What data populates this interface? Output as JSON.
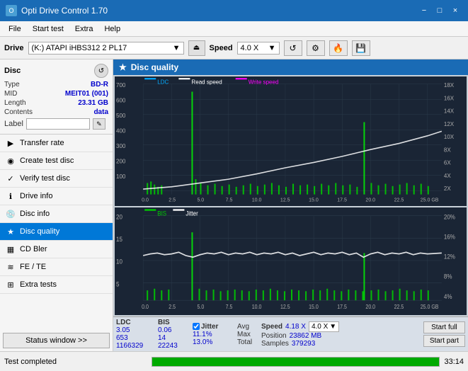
{
  "titleBar": {
    "title": "Opti Drive Control 1.70",
    "minBtn": "−",
    "maxBtn": "□",
    "closeBtn": "×"
  },
  "menuBar": {
    "items": [
      "File",
      "Start test",
      "Extra",
      "Help"
    ]
  },
  "driveBar": {
    "driveLabel": "Drive",
    "driveValue": "(K:) ATAPI iHBS312  2 PL17",
    "speedLabel": "Speed",
    "speedValue": "4.0 X"
  },
  "disc": {
    "title": "Disc",
    "typeLabel": "Type",
    "typeValue": "BD-R",
    "midLabel": "MID",
    "midValue": "MEIT01 (001)",
    "lengthLabel": "Length",
    "lengthValue": "23.31 GB",
    "contentsLabel": "Contents",
    "contentsValue": "data",
    "labelLabel": "Label"
  },
  "nav": {
    "items": [
      {
        "id": "transfer-rate",
        "label": "Transfer rate",
        "icon": "▶"
      },
      {
        "id": "create-test-disc",
        "label": "Create test disc",
        "icon": "◉"
      },
      {
        "id": "verify-test-disc",
        "label": "Verify test disc",
        "icon": "✓"
      },
      {
        "id": "drive-info",
        "label": "Drive info",
        "icon": "ℹ"
      },
      {
        "id": "disc-info",
        "label": "Disc info",
        "icon": "💿"
      },
      {
        "id": "disc-quality",
        "label": "Disc quality",
        "icon": "★",
        "active": true
      },
      {
        "id": "cd-bler",
        "label": "CD Bler",
        "icon": "▦"
      },
      {
        "id": "fe-te",
        "label": "FE / TE",
        "icon": "≋"
      },
      {
        "id": "extra-tests",
        "label": "Extra tests",
        "icon": "⊞"
      }
    ],
    "statusBtn": "Status window >>"
  },
  "chart1": {
    "title": "Disc quality",
    "legends": [
      {
        "label": "LDC",
        "color": "#00aaff"
      },
      {
        "label": "Read speed",
        "color": "#ffffff"
      },
      {
        "label": "Write speed",
        "color": "#ff00ff"
      }
    ],
    "yMax": 700,
    "yLabels": [
      "700",
      "600",
      "500",
      "400",
      "300",
      "200",
      "100"
    ],
    "yRight": [
      "18X",
      "16X",
      "14X",
      "12X",
      "10X",
      "8X",
      "6X",
      "4X",
      "2X"
    ],
    "xLabels": [
      "0.0",
      "2.5",
      "5.0",
      "7.5",
      "10.0",
      "12.5",
      "15.0",
      "17.5",
      "20.0",
      "22.5",
      "25.0 GB"
    ]
  },
  "chart2": {
    "legends": [
      {
        "label": "BIS",
        "color": "#00ff00"
      },
      {
        "label": "Jitter",
        "color": "#ffffff"
      }
    ],
    "yMax": 20,
    "yLabels": [
      "20",
      "15",
      "10",
      "5"
    ],
    "yRight": [
      "20%",
      "16%",
      "12%",
      "8%",
      "4%"
    ],
    "xLabels": [
      "0.0",
      "2.5",
      "5.0",
      "7.5",
      "10.0",
      "12.5",
      "15.0",
      "17.5",
      "20.0",
      "22.5",
      "25.0 GB"
    ]
  },
  "stats": {
    "ldcLabel": "LDC",
    "bisLabel": "BIS",
    "jitterLabel": "Jitter",
    "speedLabel": "Speed",
    "avgLabel": "Avg",
    "maxLabel": "Max",
    "totalLabel": "Total",
    "avgLdc": "3.05",
    "avgBis": "0.06",
    "avgJitter": "11.1%",
    "maxLdc": "653",
    "maxBis": "14",
    "maxJitter": "13.0%",
    "totalLdc": "1166329",
    "totalBis": "22243",
    "speedValue": "4.18 X",
    "speedSelect": "4.0 X",
    "positionLabel": "Position",
    "positionValue": "23862 MB",
    "samplesLabel": "Samples",
    "samplesValue": "379293",
    "startFull": "Start full",
    "startPart": "Start part"
  },
  "statusBar": {
    "text": "Test completed",
    "progress": 100,
    "time": "33:14"
  }
}
